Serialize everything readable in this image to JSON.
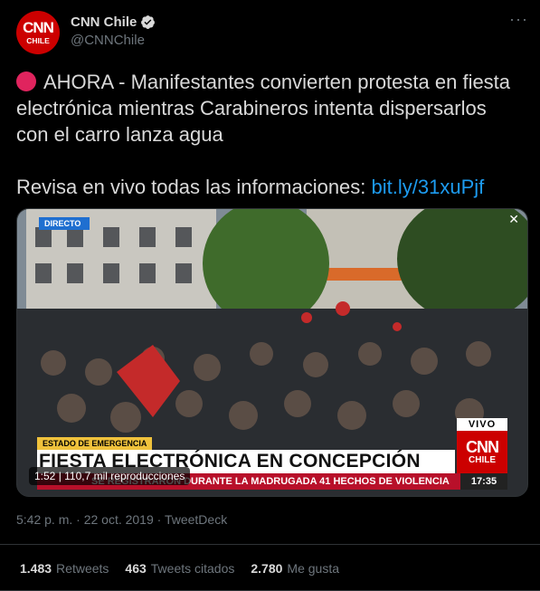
{
  "account": {
    "display_name": "CNN Chile",
    "handle": "@CNNChile",
    "avatar_text_1": "CNN",
    "avatar_text_2": "CHILE",
    "verified": true
  },
  "tweet": {
    "line1": "AHORA - Manifestantes convierten protesta en fiesta electrónica mientras Carabineros intenta dispersarlos con el carro lanza agua",
    "line2_text": "Revisa en vivo todas las informaciones: ",
    "line2_link": "bit.ly/31xuPjf"
  },
  "media": {
    "directo_label": "DIRECTO",
    "estado_label": "ESTADO DE EMERGENCIA",
    "banner_text": "FIESTA ELECTRÓNICA EN CONCEPCIÓN",
    "ticker_text": "SE REGISTRARON DURANTE LA MADRUGADA 41 HECHOS DE VIOLENCIA",
    "ticker_time": "17:35",
    "vivo_label": "VIVO",
    "bug_cnn": "CNN",
    "bug_chile": "CHILE",
    "views_label": "1:52 | 110,7 mil reproducciones"
  },
  "meta": {
    "timestamp": "5:42 p. m. · 22 oct. 2019 · TweetDeck"
  },
  "stats": {
    "retweets_count": "1.483",
    "retweets_label": "Retweets",
    "quotes_count": "463",
    "quotes_label": "Tweets citados",
    "likes_count": "2.780",
    "likes_label": "Me gusta"
  },
  "colors": {
    "background": "#000000",
    "accent_link": "#1d9bf0",
    "cnn_red": "#cc0000",
    "muted": "#6e767d"
  }
}
